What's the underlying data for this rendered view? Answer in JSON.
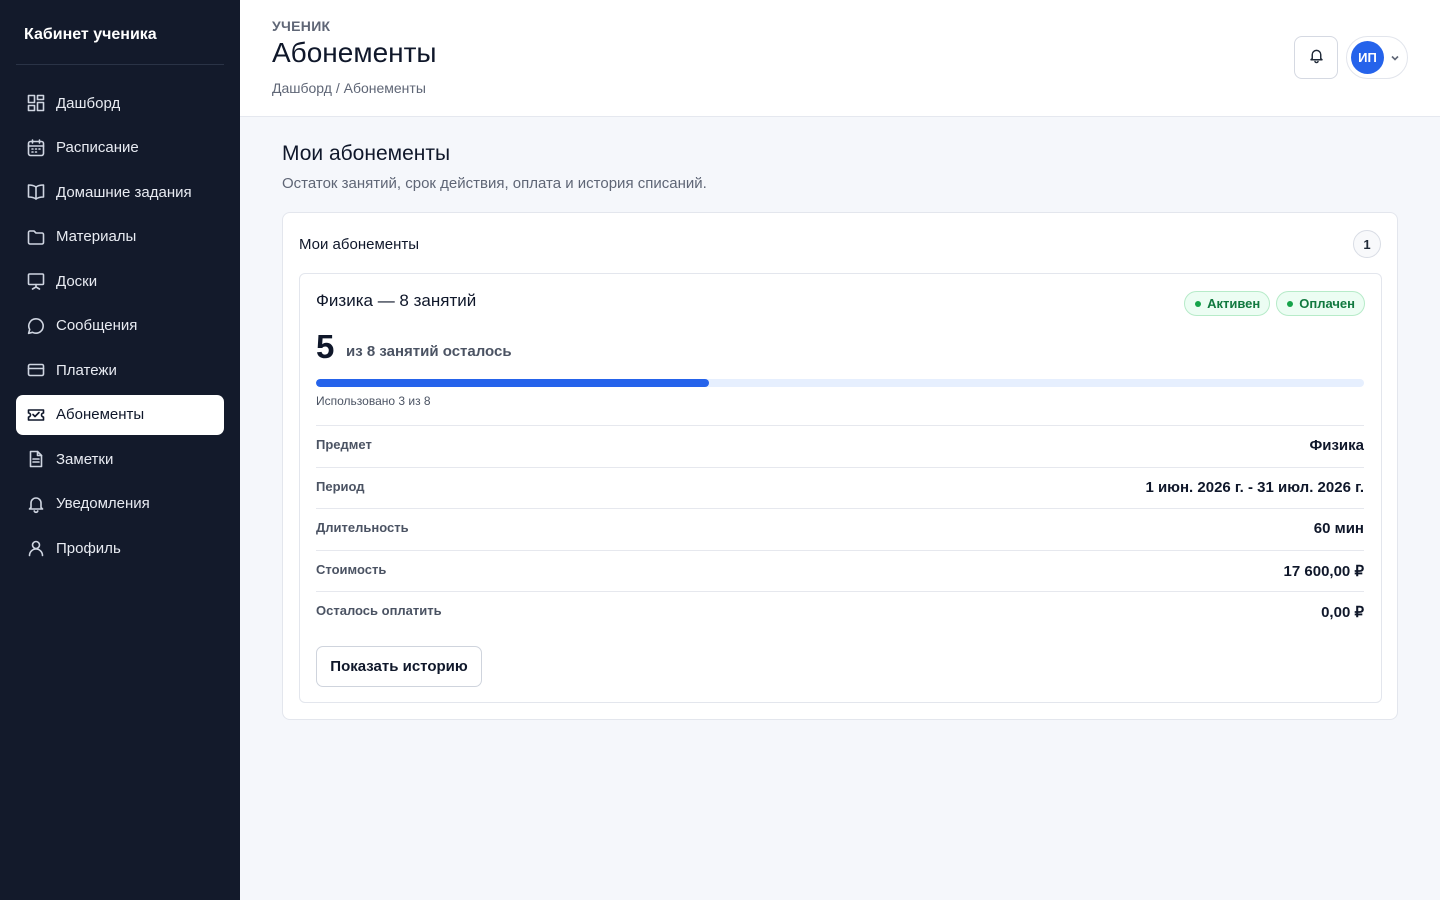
{
  "sidebar": {
    "brand": "Кабинет ученика",
    "items": [
      {
        "label": "Дашборд",
        "icon": "dashboard-icon"
      },
      {
        "label": "Расписание",
        "icon": "calendar-icon"
      },
      {
        "label": "Домашние задания",
        "icon": "book-open-icon"
      },
      {
        "label": "Материалы",
        "icon": "folder-icon"
      },
      {
        "label": "Доски",
        "icon": "whiteboard-icon"
      },
      {
        "label": "Сообщения",
        "icon": "message-icon"
      },
      {
        "label": "Платежи",
        "icon": "credit-card-icon"
      },
      {
        "label": "Абонементы",
        "icon": "ticket-icon",
        "active": true
      },
      {
        "label": "Заметки",
        "icon": "note-icon"
      },
      {
        "label": "Уведомления",
        "icon": "bell-icon"
      },
      {
        "label": "Профиль",
        "icon": "user-icon"
      }
    ]
  },
  "header": {
    "eyebrow": "УЧЕНИК",
    "title": "Абонементы",
    "breadcrumb": "Дашборд / Абонементы",
    "avatar_initials": "ИП"
  },
  "main": {
    "title": "Мои абонементы",
    "subtitle": "Остаток занятий, срок действия, оплата и история списаний.",
    "card_title": "Мои абонементы",
    "count": "1",
    "subscription": {
      "name": "Физика — 8 занятий",
      "status_active": "Активен",
      "status_paid": "Оплачен",
      "remaining": "5",
      "remaining_label": "из 8 занятий осталось",
      "used_fraction": 0.375,
      "used_caption": "Использовано 3 из 8",
      "details": [
        {
          "key": "Предмет",
          "value": "Физика"
        },
        {
          "key": "Период",
          "value": "1 июн. 2026 г. - 31 июл. 2026 г."
        },
        {
          "key": "Длительность",
          "value": "60 мин"
        },
        {
          "key": "Стоимость",
          "value": "17 600,00 ₽"
        },
        {
          "key": "Осталось оплатить",
          "value": "0,00 ₽"
        }
      ],
      "history_button": "Показать историю"
    }
  },
  "colors": {
    "sidebar_bg": "#131a2b",
    "accent": "#2563eb",
    "success": "#16a34a"
  }
}
